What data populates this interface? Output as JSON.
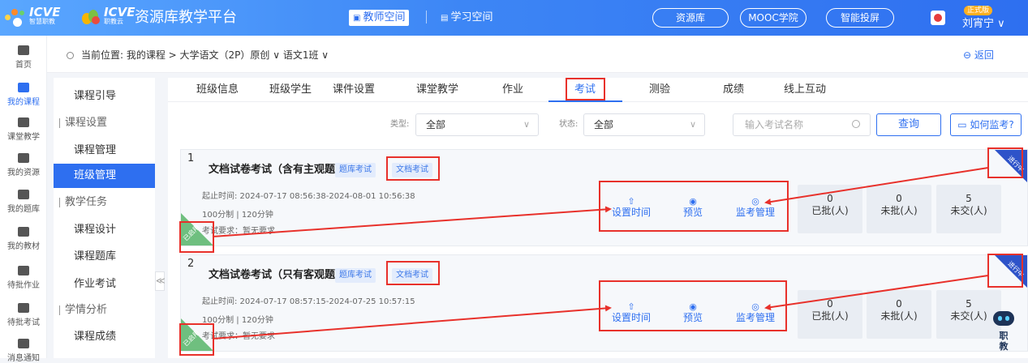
{
  "header": {
    "brand1": "ICVE",
    "brand1_sub": "智慧职教",
    "brand2": "ICVE",
    "brand2_sub": "职教云",
    "platform_title": "资源库教学平台",
    "teacher_space": "教师空间",
    "student_space": "学习空间",
    "nav_buttons": [
      "资源库",
      "MOOC学院",
      "智能投屏"
    ],
    "version_badge": "正式版",
    "username": "刘宵宁 ∨"
  },
  "left_nav": {
    "items": [
      "首页",
      "我的课程",
      "课堂教学",
      "我的资源",
      "我的题库",
      "我的教材",
      "待批作业",
      "待批考试",
      "消息通知"
    ]
  },
  "breadcrumb": {
    "text": "当前位置: 我的课程 > 大学语文（2P）原创 ∨  语文1班 ∨",
    "back": "返回"
  },
  "sidebar": {
    "items": [
      {
        "label": "课程引导",
        "type": "item"
      },
      {
        "label": "课程设置",
        "type": "group"
      },
      {
        "label": "课程管理",
        "type": "item"
      },
      {
        "label": "班级管理",
        "type": "active"
      },
      {
        "label": "教学任务",
        "type": "group"
      },
      {
        "label": "课程设计",
        "type": "item"
      },
      {
        "label": "课程题库",
        "type": "item"
      },
      {
        "label": "作业考试",
        "type": "item"
      },
      {
        "label": "学情分析",
        "type": "group"
      },
      {
        "label": "课程成绩",
        "type": "item"
      }
    ],
    "collapse_glyph": "≪"
  },
  "tabs": [
    "班级信息",
    "班级学生",
    "课件设置",
    "课堂教学",
    "作业",
    "考试",
    "测验",
    "成绩",
    "线上互动"
  ],
  "active_tab": "考试",
  "filters": {
    "type_label": "类型:",
    "type_value": "全部",
    "status_label": "状态:",
    "status_value": "全部",
    "search_placeholder": "输入考试名称",
    "query_button": "查询",
    "how_button": "如何监考?"
  },
  "exams": [
    {
      "index": "1",
      "title": "文档试卷考试（含有主观题）",
      "tags": [
        "题库考试",
        "文档考试"
      ],
      "time": "起止时间: 2024-07-17 08:56:38-2024-08-01 10:56:38",
      "score": "100分制 | 120分钟",
      "requirement": "考试要求：暂无要求",
      "actions": [
        "设置时间",
        "预览",
        "监考管理"
      ],
      "stats": [
        {
          "value": "0",
          "label": "已批(人)"
        },
        {
          "value": "0",
          "label": "未批(人)"
        },
        {
          "value": "5",
          "label": "未交(人)"
        }
      ],
      "corner_left": "已启用",
      "corner_right": "进行中"
    },
    {
      "index": "2",
      "title": "文档试卷考试（只有客观题）",
      "tags": [
        "题库考试",
        "文档考试"
      ],
      "time": "起止时间: 2024-07-17 08:57:15-2024-07-25 10:57:15",
      "score": "100分制 | 120分钟",
      "requirement": "考试要求：暂无要求",
      "actions": [
        "设置时间",
        "预览",
        "监考管理"
      ],
      "stats": [
        {
          "value": "0",
          "label": "已批(人)"
        },
        {
          "value": "0",
          "label": "未批(人)"
        },
        {
          "value": "5",
          "label": "未交(人)"
        }
      ],
      "corner_left": "已启用",
      "corner_right": "进行中"
    }
  ],
  "assistant": {
    "text": "职教"
  },
  "colors": {
    "primary": "#2e6ff0",
    "highlight": "#e8312b",
    "enabled": "#6fbf7f",
    "running": "#2e53c9"
  }
}
